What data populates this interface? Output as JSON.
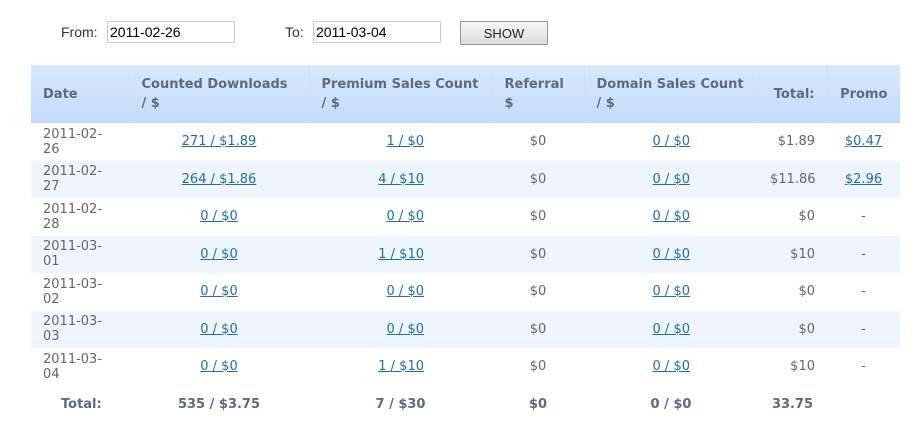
{
  "filter": {
    "from_label": "From:",
    "from_value": "2011-02-26",
    "to_label": "To:",
    "to_value": "2011-03-04",
    "show_label": "SHOW"
  },
  "table": {
    "headers": [
      "Date",
      "Counted Downloads / $",
      "Premium Sales Count / $",
      "Referral $",
      "Domain Sales Count / $",
      "Total:",
      "Promo"
    ],
    "rows": [
      [
        "2011-02-26",
        "271 / $1.89",
        "1 / $0",
        "$0",
        "0 / $0",
        "$1.89",
        "$0.47"
      ],
      [
        "2011-02-27",
        "264 / $1.86",
        "4 / $10",
        "$0",
        "0 / $0",
        "$11.86",
        "$2.96"
      ],
      [
        "2011-02-28",
        "0 / $0",
        "0 / $0",
        "$0",
        "0 / $0",
        "$0",
        "-"
      ],
      [
        "2011-03-01",
        "0 / $0",
        "1 / $10",
        "$0",
        "0 / $0",
        "$10",
        "-"
      ],
      [
        "2011-03-02",
        "0 / $0",
        "0 / $0",
        "$0",
        "0 / $0",
        "$0",
        "-"
      ],
      [
        "2011-03-03",
        "0 / $0",
        "0 / $0",
        "$0",
        "0 / $0",
        "$0",
        "-"
      ],
      [
        "2011-03-04",
        "0 / $0",
        "1 / $10",
        "$0",
        "0 / $0",
        "$10",
        "-"
      ]
    ],
    "totals": [
      "Total:",
      "535 / $3.75",
      "7 / $30",
      "$0",
      "0 / $0",
      "33.75",
      ""
    ]
  }
}
